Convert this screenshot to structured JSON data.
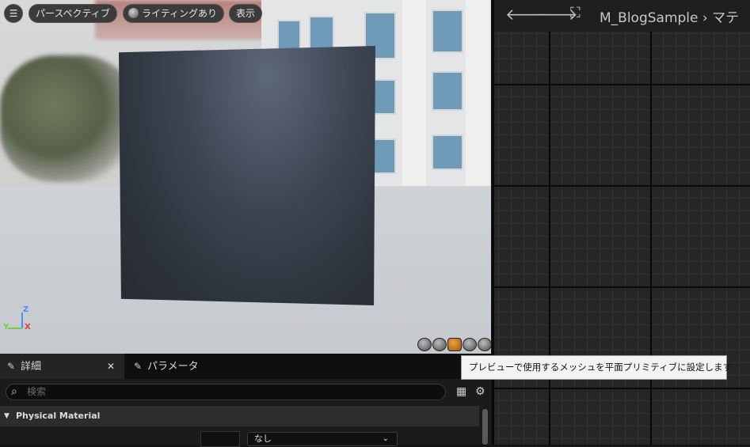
{
  "viewport": {
    "menu_icon": "hamburger-icon",
    "perspective_label": "パースペクティブ",
    "lighting_label": "ライティングあり",
    "show_label": "表示",
    "axis": {
      "z": "Z",
      "y": "Y",
      "x": "X"
    },
    "axis_colors": {
      "z": "#4a8cff",
      "y": "#6ecf3c",
      "x": "#e03c3c"
    },
    "preview_meshes": [
      "cylinder-icon",
      "sphere-icon",
      "plane-icon",
      "cube-icon",
      "custom-mesh-icon"
    ],
    "active_mesh": "plane-icon",
    "active_color": "#e8962e"
  },
  "details": {
    "tab_details": "詳細",
    "tab_params": "パラメータ",
    "search_placeholder": "検索",
    "section_title": "Physical Material",
    "combo_value": "なし"
  },
  "graph": {
    "back_icon": "arrow-left-icon",
    "forward_icon": "arrow-right-icon",
    "graph_icon": "material-graph-icon",
    "breadcrumb": "M_BlogSample",
    "breadcrumb_sep": "›",
    "breadcrumb_next": "マテ"
  },
  "tooltip": {
    "text": "プレビューで使用するメッシュを平面プリミティブに設定します"
  }
}
